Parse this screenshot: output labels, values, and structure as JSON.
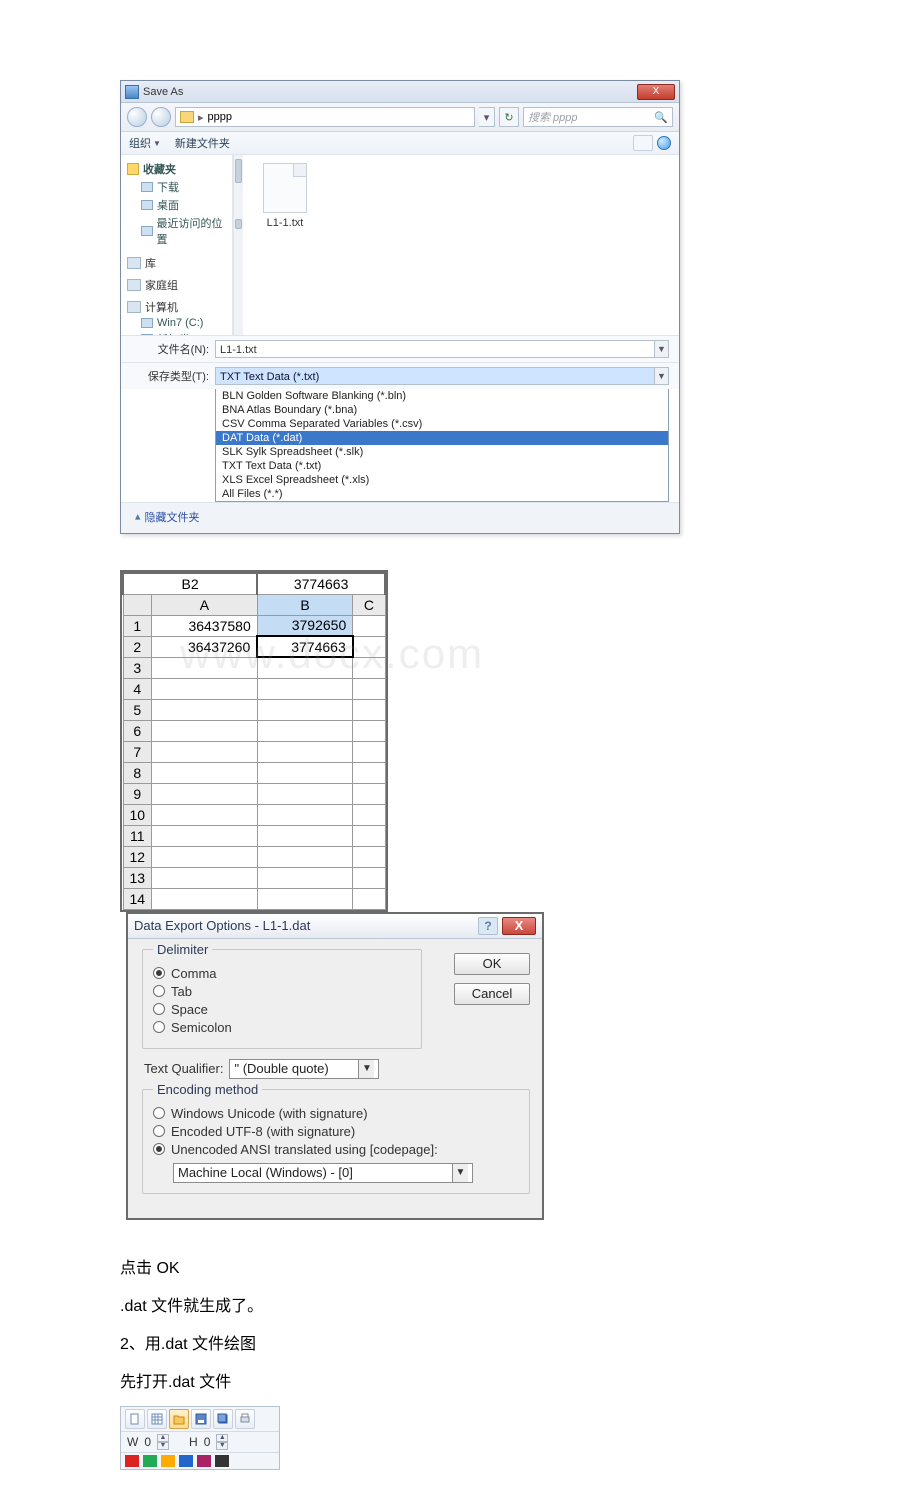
{
  "saveas": {
    "title": "Save As",
    "close_x": "X",
    "path_folder": "pppp",
    "path_sep": "▸",
    "search_placeholder": "搜索 pppp",
    "organize": "组织",
    "new_folder": "新建文件夹",
    "nav": {
      "favorites": "收藏夹",
      "downloads": "下载",
      "desktop": "桌面",
      "recent": "最近访问的位置",
      "libraries": "库",
      "homegroup": "家庭组",
      "computer": "计算机",
      "drive_c": "Win7 (C:)",
      "drive_d": "新加卷 (D:)"
    },
    "file_in_list": "L1-1.txt",
    "filename_label": "文件名(N):",
    "filename_value": "L1-1.txt",
    "filetype_label": "保存类型(T):",
    "filetype_value": "TXT Text Data (*.txt)",
    "hide_folders": "隐藏文件夹",
    "type_options": [
      "BLN Golden Software Blanking (*.bln)",
      "BNA Atlas Boundary (*.bna)",
      "CSV Comma Separated Variables (*.csv)",
      "DAT Data (*.dat)",
      "SLK Sylk Spreadsheet (*.slk)",
      "TXT Text Data (*.txt)",
      "XLS Excel Spreadsheet (*.xls)",
      "All Files (*.*)"
    ]
  },
  "sheet": {
    "active_cell": "B2",
    "active_value": "3774663",
    "cols": [
      "A",
      "B",
      "C"
    ],
    "rows": {
      "1": {
        "A": "36437580",
        "B": "3792650"
      },
      "2": {
        "A": "36437260",
        "B": "3774663"
      }
    },
    "row_count": 14
  },
  "export": {
    "title": "Data Export Options - L1-1.dat",
    "ok": "OK",
    "cancel": "Cancel",
    "delimiter_legend": "Delimiter",
    "delim_comma": "Comma",
    "delim_tab": "Tab",
    "delim_space": "Space",
    "delim_semicolon": "Semicolon",
    "tq_label": "Text Qualifier:",
    "tq_value": "\" (Double quote)",
    "enc_legend": "Encoding method",
    "enc_unicode": "Windows Unicode (with signature)",
    "enc_utf8": "Encoded UTF-8 (with signature)",
    "enc_ansi": "Unencoded ANSI translated using [codepage]:",
    "codepage": "Machine Local (Windows) - [0]"
  },
  "body_text": {
    "p1": "点击 OK",
    "p2": ".dat 文件就生成了。",
    "p3": "2、用.dat 文件绘图",
    "p4": "先打开.dat 文件"
  },
  "mini": {
    "w_label": "W",
    "w_value": "0",
    "h_label": "H",
    "h_value": "0"
  }
}
